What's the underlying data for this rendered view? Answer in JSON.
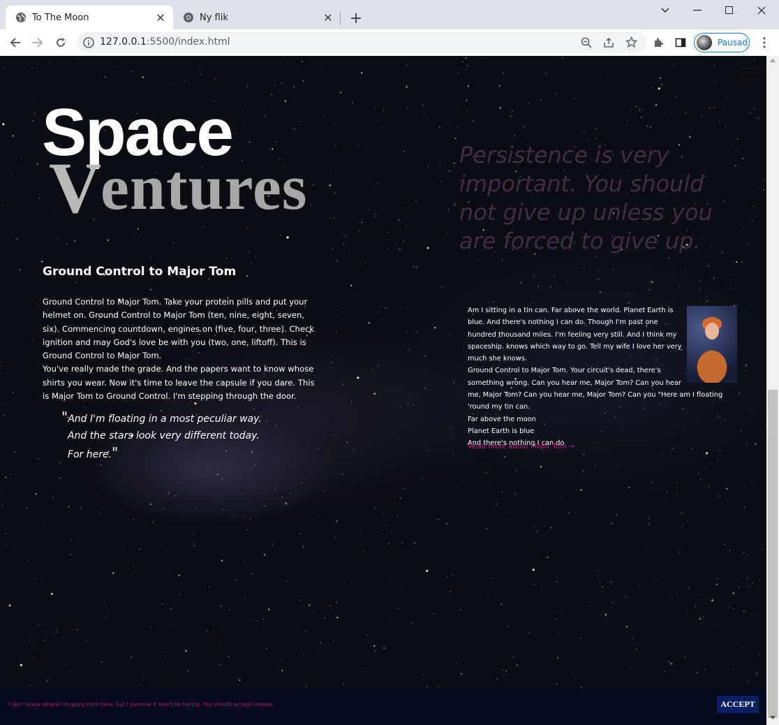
{
  "browser": {
    "tabs": [
      {
        "label": "To The Moon",
        "favicon": "globe-icon",
        "active": true
      },
      {
        "label": "Ny flik",
        "favicon": "chrome-icon",
        "active": false
      }
    ],
    "url_host": "127.0.0.1",
    "url_rest": ":5500/index.html",
    "profile_label": "Pausad"
  },
  "page": {
    "logo_top": "Space",
    "logo_v": "V",
    "logo_bottom": "entures",
    "big_quote": "Persistence is very important. You should not give up unless you are forced to give up.",
    "section_title": "Ground Control to Major Tom",
    "left_paragraph": "Ground Control to Major Tom. Take your protein pills and put your helmet on. Ground Control to Major Tom (ten, nine, eight, seven, six). Commencing countdown, engines on (five, four, three). Check ignition and may God's love be with you (two, one, liftoff). This is Ground Control to Major Tom.",
    "left_paragraph_2": "You've really made the grade. And the papers want to know whose shirts you wear. Now it's time to leave the capsule if you dare. This is Major Tom to Ground Control. I'm stepping through the door.",
    "pullquote": {
      "line1": "And I'm floating in a most peculiar way.",
      "line2": "And the stars look very different today.",
      "line3": "For here."
    },
    "right_text": {
      "p1": "Am I sitting in a tin can. Far above the world. Planet Earth is blue. And there's nothing I can do. Though I'm past one hundred thousand miles. I'm feeling very still. And I think my spaceship. knows which way to go. Tell my wife I love her very much she knows.",
      "p2": "Ground Control to Major Tom. Your circuit's dead, there's something wrong. Can you hear me, Major Tom? Can you hear me, Major Tom? Can you hear me, Major Tom? Can you \"Here am I floating 'round my tin can.",
      "l1": "Far above the moon",
      "l2": "Planet Earth is blue",
      "l3": "And there's nothing I can do"
    },
    "read_more": "Read more about Major Tom →",
    "cookie_message": "I don't know where I'm going from here, but I promise it won't be boring. You should accept cookies.",
    "accept_label": "ACCEPT"
  },
  "colors": {
    "accent_link": "#c0178a",
    "cookie_bar": "#050a1f",
    "accept_bg": "#0a1f63"
  }
}
